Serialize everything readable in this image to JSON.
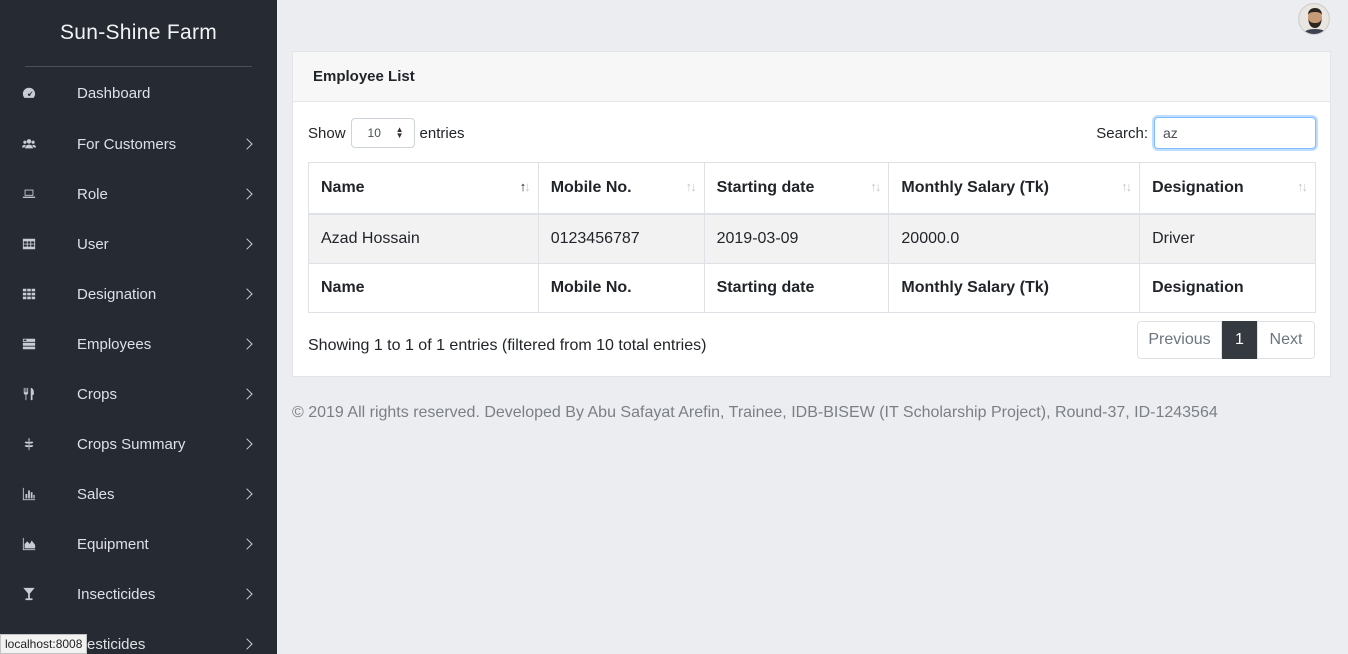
{
  "sidebar": {
    "brand": "Sun-Shine Farm",
    "items": [
      {
        "label": "Dashboard",
        "icon": "dashboard-icon",
        "has_submenu": false
      },
      {
        "label": "For Customers",
        "icon": "users-icon",
        "has_submenu": true
      },
      {
        "label": "Role",
        "icon": "laptop-icon",
        "has_submenu": true
      },
      {
        "label": "User",
        "icon": "table-icon",
        "has_submenu": true
      },
      {
        "label": "Designation",
        "icon": "grid-icon",
        "has_submenu": true
      },
      {
        "label": "Employees",
        "icon": "list-icon",
        "has_submenu": true
      },
      {
        "label": "Crops",
        "icon": "utensils-icon",
        "has_submenu": true
      },
      {
        "label": "Crops Summary",
        "icon": "leaf-icon",
        "has_submenu": true
      },
      {
        "label": "Sales",
        "icon": "bar-chart-icon",
        "has_submenu": true
      },
      {
        "label": "Equipment",
        "icon": "area-chart-icon",
        "has_submenu": true
      },
      {
        "label": "Insecticides",
        "icon": "glass-icon",
        "has_submenu": true
      },
      {
        "label": "Pesticides",
        "icon": "flask-icon",
        "has_submenu": true
      }
    ]
  },
  "header": {
    "avatar": "user-avatar"
  },
  "card": {
    "title": "Employee List",
    "show_label": "Show",
    "entries_label": "entries",
    "page_size": "10",
    "search_label": "Search:",
    "search_value": "az",
    "columns": [
      "Name",
      "Mobile No.",
      "Starting date",
      "Monthly Salary (Tk)",
      "Designation"
    ],
    "rows": [
      [
        "Azad Hossain",
        "0123456787",
        "2019-03-09",
        "20000.0",
        "Driver"
      ]
    ],
    "info": "Showing 1 to 1 of 1 entries (filtered from 10 total entries)",
    "pagination": {
      "previous": "Previous",
      "current": "1",
      "next": "Next"
    }
  },
  "footer": "© 2019 All rights reserved. Developed By Abu Safayat Arefin, Trainee, IDB-BISEW (IT Scholarship Project), Round-37, ID-1243564",
  "status_bar": "localhost:8008"
}
